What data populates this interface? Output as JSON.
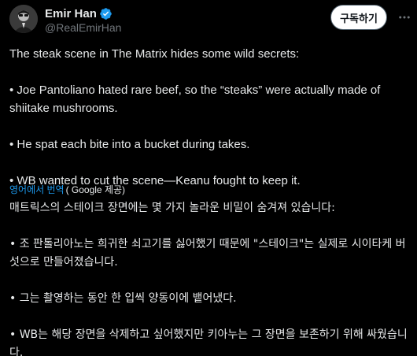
{
  "post": {
    "author": {
      "display_name": "Emir Han",
      "handle": "@RealEmirHan",
      "verified_icon": "verified-badge-icon",
      "avatar_icon": "avatar"
    },
    "subscribe_label": "구독하기",
    "more_icon": "more-options-icon",
    "text": {
      "line1": "The steak scene in The Matrix hides some wild secrets:",
      "bullet1": "• Joe Pantoliano hated rare beef, so the “steaks” were actually made of shiitake mushrooms.",
      "bullet2": "• He spat each bite into a bucket during takes.",
      "bullet3": "• WB wanted to cut the scene—Keanu fought to keep it."
    },
    "translation": {
      "link_label": "영어에서 번역",
      "by_label": "( Google 제공)",
      "line1": "매트릭스의 스테이크 장면에는 몇 가지 놀라운 비밀이 숨겨져 있습니다:",
      "bullet1": "• 조 판톨리아노는 희귀한 쇠고기를 싫어했기 때문에 \"스테이크\"는 실제로 시이타케 버섯으로 만들어졌습니다.",
      "bullet2": "• 그는 촬영하는 동안 한 입씩 양동이에 뱉어냈다.",
      "bullet3": "• WB는 해당 장면을 삭제하고 싶어했지만 키아누는 그 장면을 보존하기 위해 싸웠습니다."
    }
  },
  "colors": {
    "background": "#000000",
    "text": "#e7e9ea",
    "secondary": "#71767b",
    "link": "#1d9bf0",
    "verified": "#1d9bf0"
  }
}
